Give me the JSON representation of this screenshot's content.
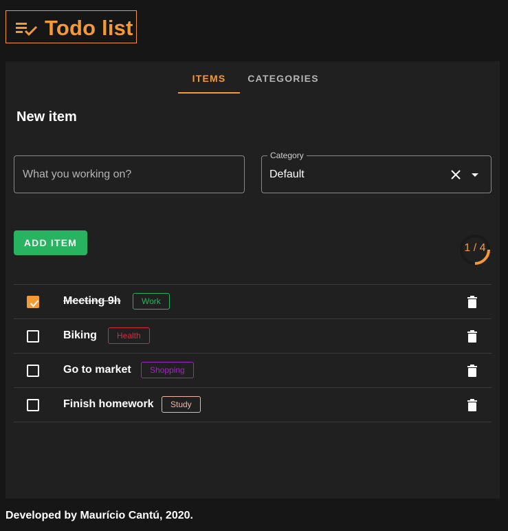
{
  "header": {
    "title": "Todo list",
    "icon": "playlist-check-icon",
    "accent_color": "#f39a37"
  },
  "tabs": [
    {
      "label": "ITEMS",
      "active": true
    },
    {
      "label": "CATEGORIES",
      "active": false
    }
  ],
  "new_item": {
    "title": "New item",
    "input_placeholder": "What you working on?",
    "input_value": "",
    "category_label": "Category",
    "category_value": "Default",
    "add_button_label": "ADD ITEM",
    "add_button_color": "#27b35f"
  },
  "progress": {
    "text": "1 / 4",
    "completed": 1,
    "total": 4
  },
  "items": [
    {
      "name": "Meeting 9h",
      "done": true,
      "tag": "Work",
      "tag_color": "#27b35f"
    },
    {
      "name": "Biking",
      "done": false,
      "tag": "Health",
      "tag_color": "#e0283a"
    },
    {
      "name": "Go to market",
      "done": false,
      "tag": "Shopping",
      "tag_color": "#a423c9"
    },
    {
      "name": "Finish homework",
      "done": false,
      "tag": "Study",
      "tag_color": "#f4b6a8"
    }
  ],
  "footer": {
    "text": "Developed by Maurício Cantú, 2020."
  }
}
